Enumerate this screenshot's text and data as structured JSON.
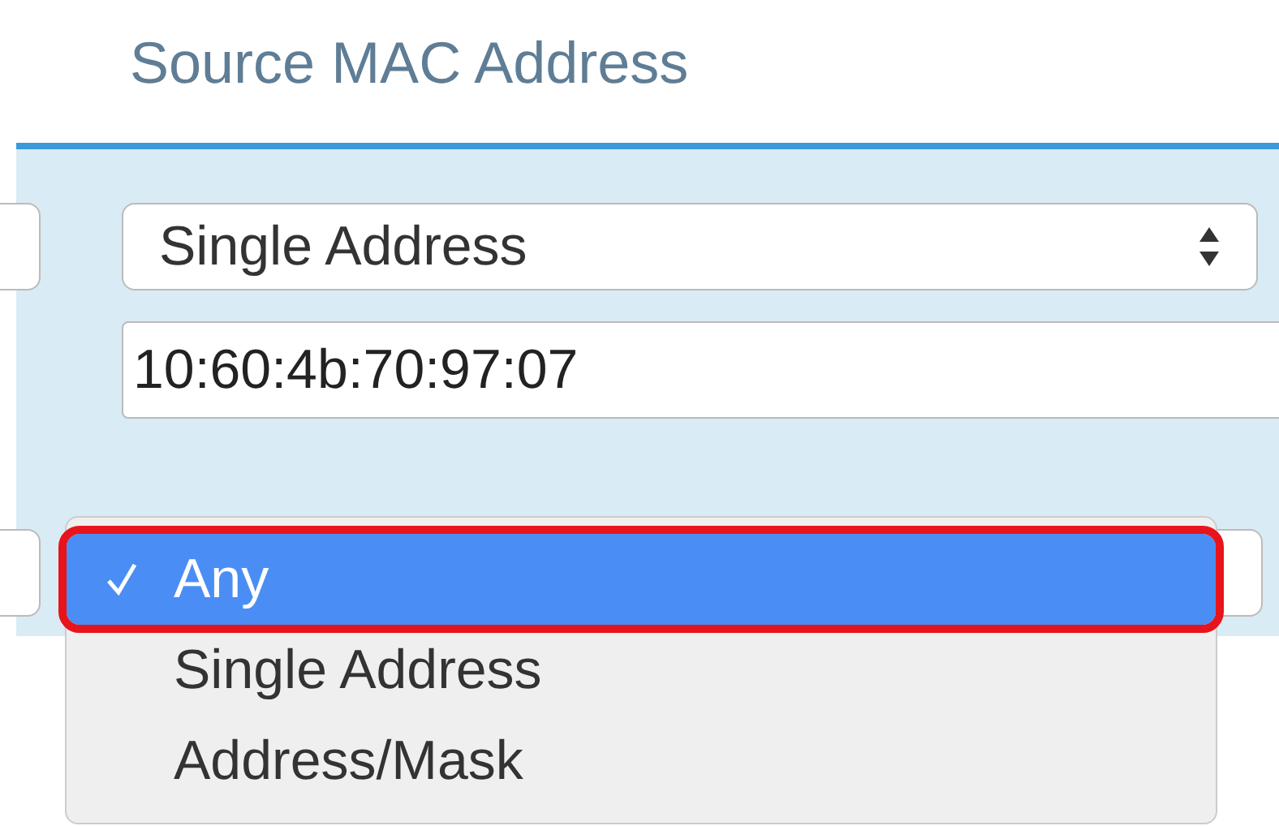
{
  "heading": "Source MAC Address",
  "type_select": {
    "value": "Single Address"
  },
  "address_field": {
    "value": "10:60:4b:70:97:07"
  },
  "dropdown": {
    "options": [
      {
        "label": "Any",
        "selected": true,
        "highlighted": true
      },
      {
        "label": "Single Address",
        "selected": false,
        "highlighted": false
      },
      {
        "label": "Address/Mask",
        "selected": false,
        "highlighted": false
      }
    ]
  }
}
